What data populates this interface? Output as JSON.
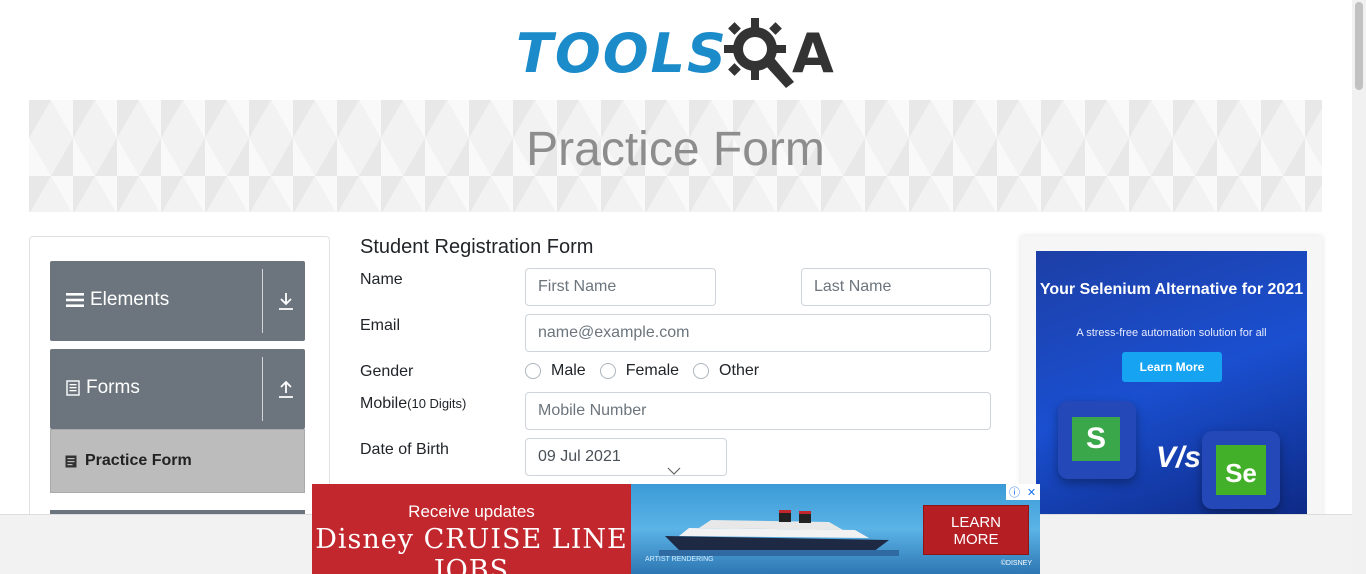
{
  "logo": {
    "text_main": "TOOLS",
    "text_q": "Q",
    "text_a": "A"
  },
  "banner": {
    "title": "Practice Form"
  },
  "sidebar": {
    "groups": [
      {
        "label": "Elements",
        "icon": "menu-icon",
        "arrow": "download-icon"
      },
      {
        "label": "Forms",
        "icon": "document-icon",
        "arrow": "upload-icon"
      }
    ],
    "active_item": {
      "label": "Practice Form",
      "icon": "document-icon"
    }
  },
  "form": {
    "title": "Student Registration Form",
    "name_label": "Name",
    "first_name_placeholder": "First Name",
    "last_name_placeholder": "Last Name",
    "email_label": "Email",
    "email_placeholder": "name@example.com",
    "gender_label": "Gender",
    "genders": [
      "Male",
      "Female",
      "Other"
    ],
    "mobile_label": "Mobile",
    "mobile_hint": "(10 Digits)",
    "mobile_placeholder": "Mobile Number",
    "dob_label": "Date of Birth",
    "dob_value": "09 Jul 2021"
  },
  "ad_right": {
    "headline": "Your Selenium Alternative for 2021",
    "subline": "A stress-free automation solution for all",
    "cta": "Learn More",
    "vs": "V/s",
    "tile_left": "S",
    "tile_right": "Se"
  },
  "ad_bottom": {
    "line1": "Receive updates",
    "line2": "Disney CRUISE LINE JOBS",
    "cta_line1": "LEARN",
    "cta_line2": "MORE",
    "fine_print": "ARTIST RENDERING",
    "copyright": "©DISNEY"
  },
  "colors": {
    "brand_blue": "#1b8bc9",
    "sidebar_gray": "#6c757d",
    "active_gray": "#bcbcbc",
    "ad_red": "#c1272d"
  }
}
